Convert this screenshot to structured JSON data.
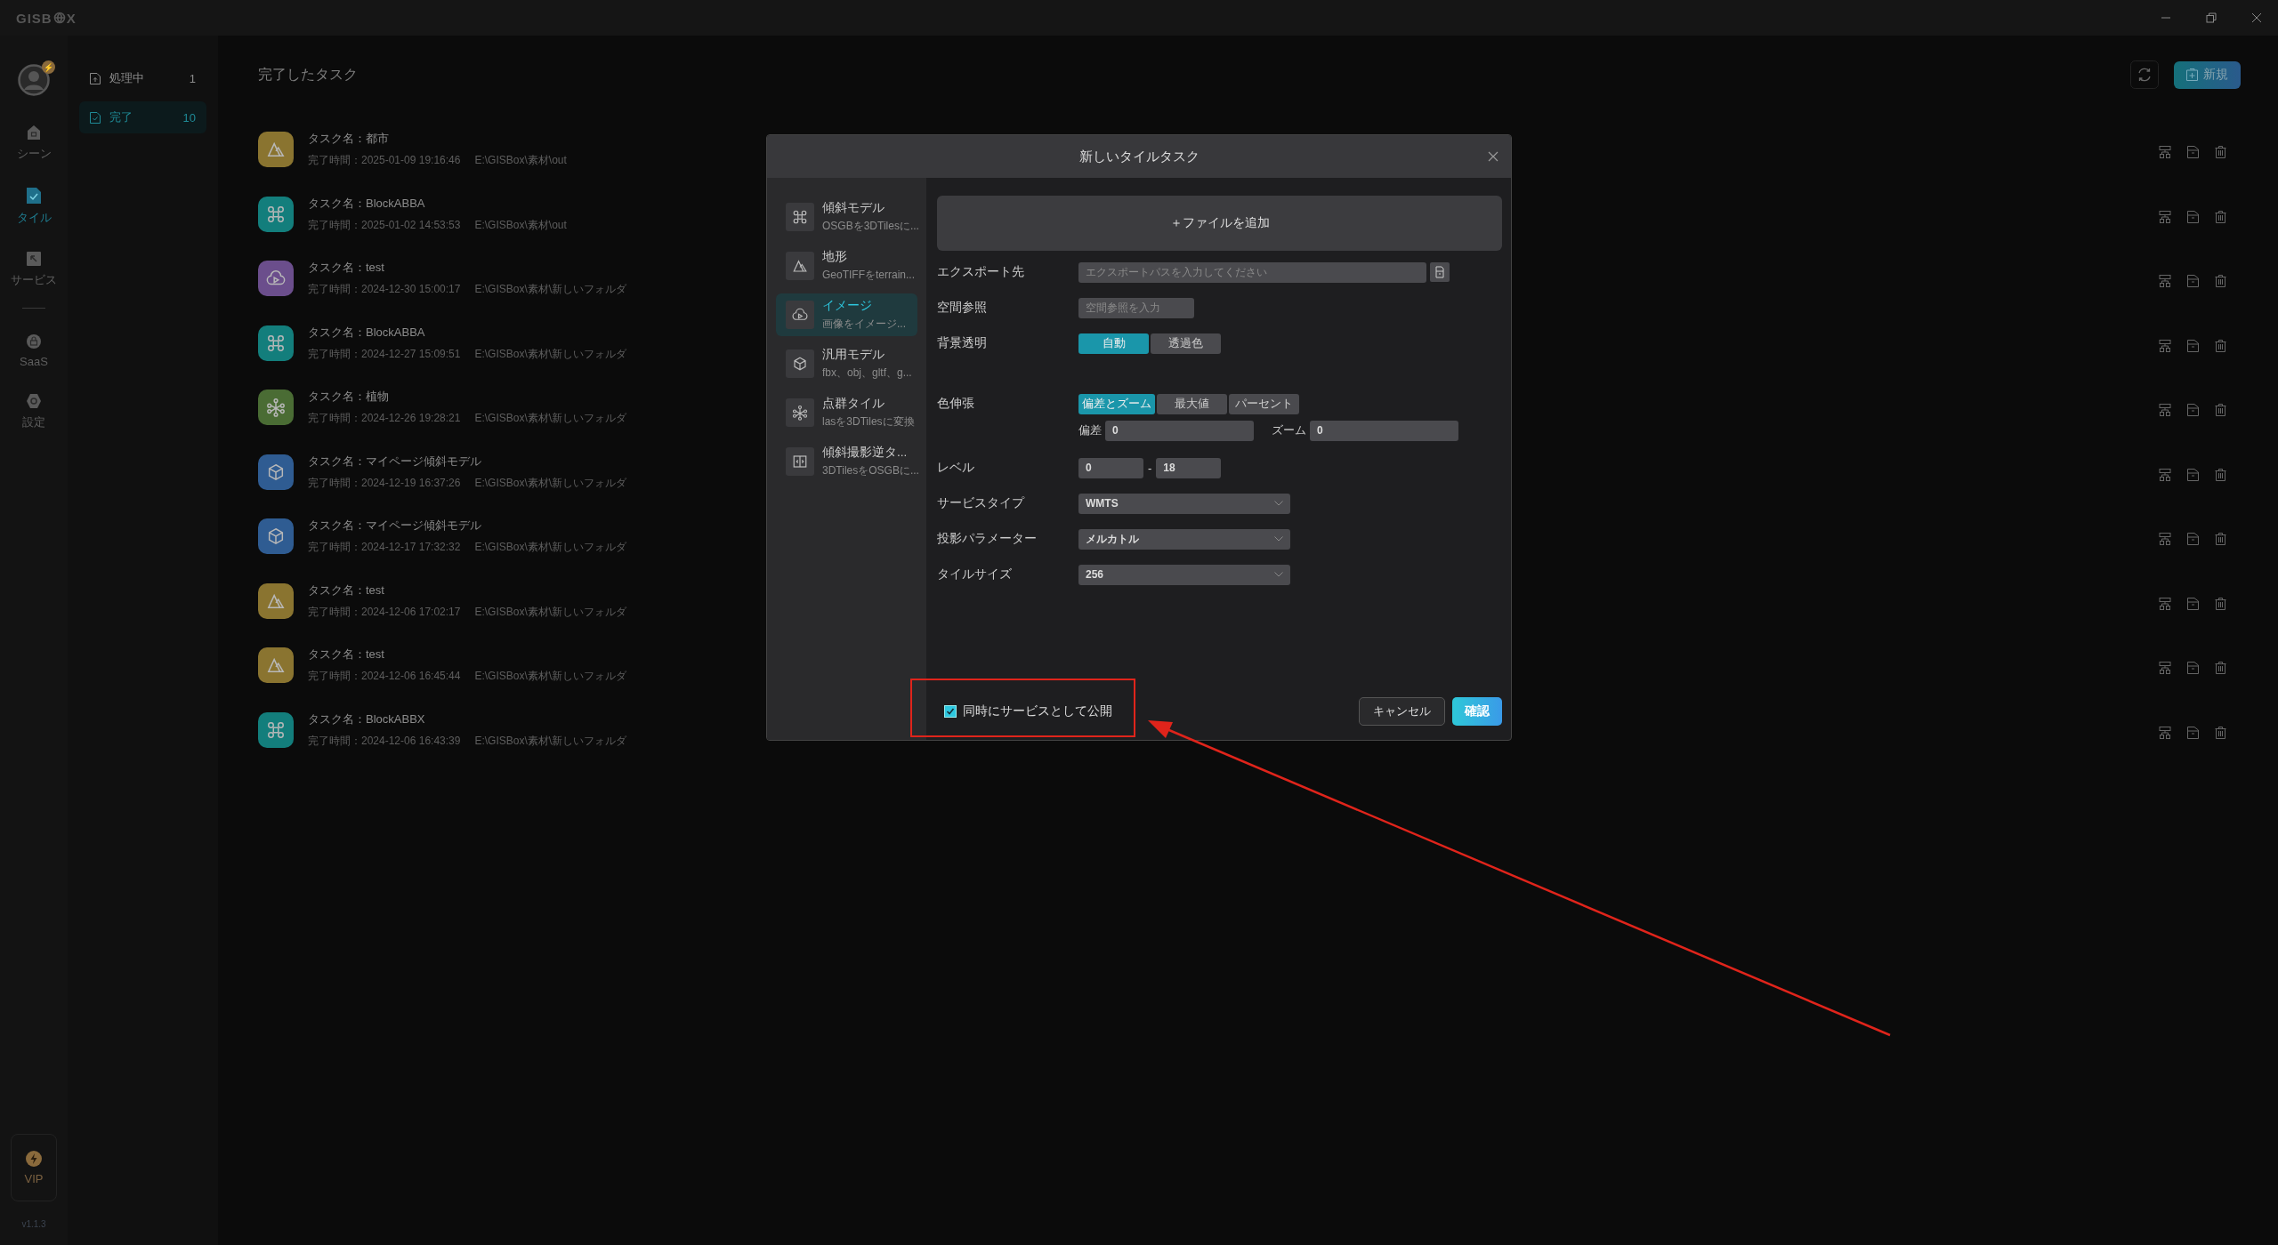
{
  "titlebar": {
    "logo_left": "GISB",
    "logo_right": "X"
  },
  "nav": {
    "badge": "⚡",
    "items": [
      {
        "kind": "scene",
        "label": "シーン",
        "selected": false
      },
      {
        "kind": "tile",
        "label": "タイル",
        "selected": true
      },
      {
        "kind": "service",
        "label": "サービス",
        "selected": false
      },
      {
        "kind": "saas",
        "label": "SaaS",
        "selected": false
      },
      {
        "kind": "settings",
        "label": "設定",
        "selected": false
      }
    ],
    "vip": "VIP",
    "version": "v1.1.3"
  },
  "subnav": [
    {
      "kind": "processing",
      "label": "処理中",
      "count": "1",
      "selected": false
    },
    {
      "kind": "done",
      "label": "完了",
      "count": "10",
      "selected": true
    }
  ],
  "main": {
    "title": "完了したタスク",
    "new_button": "新規"
  },
  "tasks": [
    {
      "kind": "terrain",
      "name": "タスク名：都市",
      "time": "完了時間：2025-01-09 19:16:46",
      "path": "E:\\GISBox\\素材\\out"
    },
    {
      "kind": "oblique",
      "name": "タスク名：BlockABBA",
      "time": "完了時間：2025-01-02 14:53:53",
      "path": "E:\\GISBox\\素材\\out"
    },
    {
      "kind": "image",
      "name": "タスク名：test",
      "time": "完了時間：2024-12-30 15:00:17",
      "path": "E:\\GISBox\\素材\\新しいフォルダ"
    },
    {
      "kind": "oblique",
      "name": "タスク名：BlockABBA",
      "time": "完了時間：2024-12-27 15:09:51",
      "path": "E:\\GISBox\\素材\\新しいフォルダ"
    },
    {
      "kind": "pointcloud",
      "name": "タスク名：植物",
      "time": "完了時間：2024-12-26 19:28:21",
      "path": "E:\\GISBox\\素材\\新しいフォルダ"
    },
    {
      "kind": "model",
      "name": "タスク名：マイページ傾斜モデル",
      "time": "完了時間：2024-12-19 16:37:26",
      "path": "E:\\GISBox\\素材\\新しいフォルダ"
    },
    {
      "kind": "model",
      "name": "タスク名：マイページ傾斜モデル",
      "time": "完了時間：2024-12-17 17:32:32",
      "path": "E:\\GISBox\\素材\\新しいフォルダ"
    },
    {
      "kind": "terrain",
      "name": "タスク名：test",
      "time": "完了時間：2024-12-06 17:02:17",
      "path": "E:\\GISBox\\素材\\新しいフォルダ"
    },
    {
      "kind": "terrain",
      "name": "タスク名：test",
      "time": "完了時間：2024-12-06 16:45:44",
      "path": "E:\\GISBox\\素材\\新しいフォルダ"
    },
    {
      "kind": "oblique",
      "name": "タスク名：BlockABBX",
      "time": "完了時間：2024-12-06 16:43:39",
      "path": "E:\\GISBox\\素材\\新しいフォルダ"
    }
  ],
  "dialog": {
    "title": "新しいタイルタスク",
    "types": [
      {
        "kind": "oblique",
        "title": "傾斜モデル",
        "desc": "OSGBを3DTilesに...",
        "selected": false
      },
      {
        "kind": "terrain",
        "title": "地形",
        "desc": "GeoTIFFをterrain...",
        "selected": false
      },
      {
        "kind": "image",
        "title": "イメージ",
        "desc": "画像をイメージ...",
        "selected": true
      },
      {
        "kind": "model",
        "title": "汎用モデル",
        "desc": "fbx、obj、gltf、g...",
        "selected": false
      },
      {
        "kind": "pointcloud",
        "title": "点群タイル",
        "desc": "lasを3DTilesに変換",
        "selected": false
      },
      {
        "kind": "reverse",
        "title": "傾斜撮影逆タ...",
        "desc": "3DTilesをOSGBに...",
        "selected": false
      }
    ],
    "add_file": "＋ファイルを追加",
    "export_label": "エクスポート先",
    "export_placeholder": "エクスポートパスを入力してください",
    "srs_label": "空間参照",
    "srs_placeholder": "空間参照を入力",
    "bg_label": "背景透明",
    "bg_options": [
      {
        "label": "自動",
        "selected": true
      },
      {
        "label": "透過色",
        "selected": false
      }
    ],
    "stretch_label": "色伸張",
    "stretch_options": [
      {
        "label": "偏差とズーム",
        "selected": true
      },
      {
        "label": "最大値",
        "selected": false
      },
      {
        "label": "パーセント",
        "selected": false
      }
    ],
    "deviation_label": "偏差",
    "deviation_value": "0",
    "zoom_label": "ズーム",
    "zoom_value": "0",
    "level_label": "レベル",
    "level_min": "0",
    "level_sep": "-",
    "level_max": "18",
    "selects": [
      {
        "label": "サービスタイプ",
        "value": "WMTS"
      },
      {
        "label": "投影パラメーター",
        "value": "メルカトル"
      },
      {
        "label": "タイルサイズ",
        "value": "256"
      }
    ],
    "publish": {
      "label": "同時にサービスとして公開",
      "checked": true
    },
    "cancel": "キャンセル",
    "confirm": "確認"
  }
}
